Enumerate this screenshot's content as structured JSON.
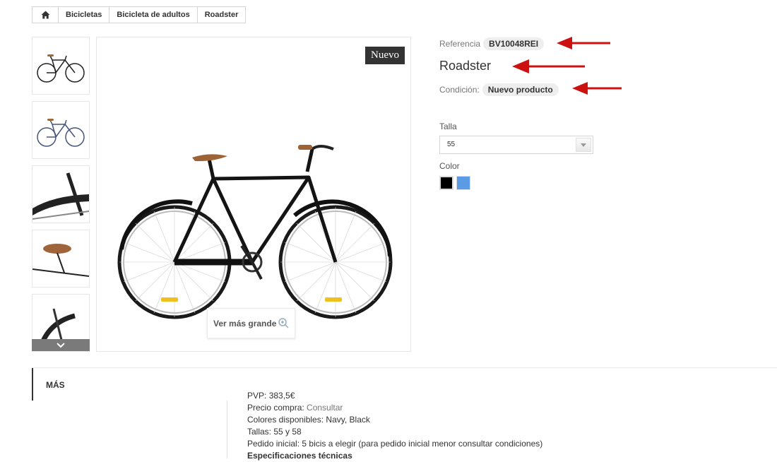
{
  "breadcrumb": {
    "items": [
      "Bicicletas",
      "Bicicleta de adultos",
      "Roadster"
    ]
  },
  "image": {
    "badge": "Nuevo",
    "zoom_label": "Ver más grande"
  },
  "product": {
    "reference_label": "Referencia",
    "reference_value": "BV10048REI",
    "name": "Roadster",
    "condition_label": "Condición:",
    "condition_value": "Nuevo producto"
  },
  "options": {
    "size_label": "Talla",
    "size_value": "55",
    "color_label": "Color",
    "colors": [
      "#000000",
      "#5b9be6"
    ]
  },
  "tabs": {
    "more_label": "MÁS"
  },
  "description": {
    "pvp_label": "PVP:",
    "pvp_value": "383,5€",
    "price_label": "Precio compra:",
    "price_value": "Consultar",
    "colors_label": "Colores disponibles:",
    "colors_value": "Navy, Black",
    "sizes_label": "Tallas:",
    "sizes_value": "55 y 58",
    "order_label": "Pedido inicial:",
    "order_value": "5 bicis a elegir (para pedido inicial menor consultar condiciones)",
    "specs_heading": "Especificaciones técnicas"
  },
  "annotation_color": "#cc1111"
}
